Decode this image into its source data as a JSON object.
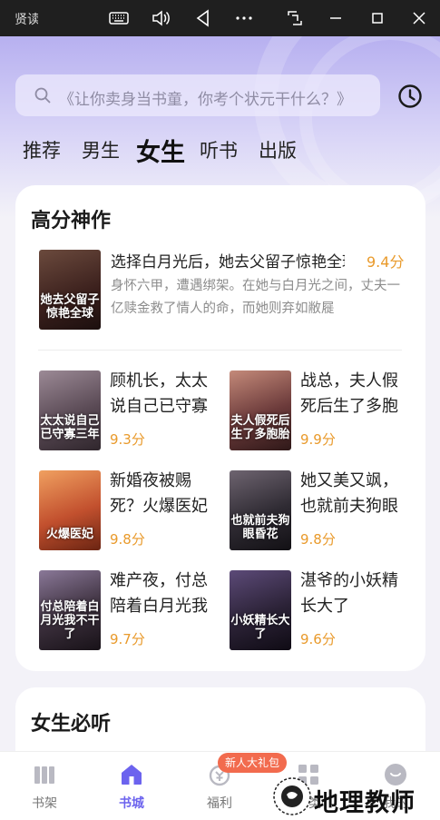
{
  "window": {
    "app_name": "贤读",
    "buttons": [
      "keyboard-icon",
      "volume-icon",
      "back-icon",
      "more-icon",
      "screenshot-icon",
      "minimize-icon",
      "maximize-icon",
      "close-icon"
    ]
  },
  "search": {
    "placeholder": "《让你卖身当书童，你考个状元干什么？》"
  },
  "tabs": [
    {
      "label": "推荐",
      "active": false
    },
    {
      "label": "男生",
      "active": false
    },
    {
      "label": "女生",
      "active": true
    },
    {
      "label": "听书",
      "active": false
    },
    {
      "label": "出版",
      "active": false
    }
  ],
  "section1": {
    "title": "高分神作",
    "featured": {
      "title": "选择白月光后，她去父留子惊艳全球",
      "score": "9.4分",
      "description": "身怀六甲，遭遇绑架。在她与白月光之间，丈夫一亿赎金救了情人的命，而她则弃如敝屣",
      "cover_text": "她去父留子惊艳全球",
      "cover_color": "#3a1f1c"
    },
    "books": [
      {
        "title": "顾机长，太太说自己已守寡三年",
        "score": "9.3分",
        "cover_text": "太太说自己已守寡三年",
        "cover_color": "#5a4a55"
      },
      {
        "title": "战总，夫人假死后生了多胞胎",
        "score": "9.9分",
        "cover_text": "夫人假死后生了多胞胎",
        "cover_color": "#6b3a3a"
      },
      {
        "title": "新婚夜被赐死？火爆医妃",
        "score": "9.8分",
        "cover_text": "火爆医妃",
        "cover_color": "#c2502e"
      },
      {
        "title": "她又美又飒，也就前夫狗眼昏花",
        "score": "9.8分",
        "cover_text": "也就前夫狗眼昏花",
        "cover_color": "#2f2b33"
      },
      {
        "title": "难产夜，付总陪着白月光我不干了",
        "score": "9.7分",
        "cover_text": "付总陪着白月光我不干了",
        "cover_color": "#3b2f3c"
      },
      {
        "title": "湛爷的小妖精长大了",
        "score": "9.6分",
        "cover_text": "小妖精长大了",
        "cover_color": "#2b2236"
      }
    ]
  },
  "section2": {
    "title": "女生必听"
  },
  "bottom_nav": {
    "items": [
      {
        "label": "书架",
        "icon": "bookshelf-icon",
        "active": false
      },
      {
        "label": "书城",
        "icon": "store-icon",
        "active": true
      },
      {
        "label": "福利",
        "icon": "welfare-icon",
        "active": false
      },
      {
        "label": "分类",
        "icon": "category-icon",
        "active": false
      },
      {
        "label": "我的",
        "icon": "profile-icon",
        "active": false
      }
    ],
    "promo_badge": "新人大礼包"
  },
  "watermark": {
    "text": "地理教师"
  },
  "colors": {
    "accent": "#6c63ee",
    "score": "#e99a2b",
    "promo": "#f26b4e"
  }
}
